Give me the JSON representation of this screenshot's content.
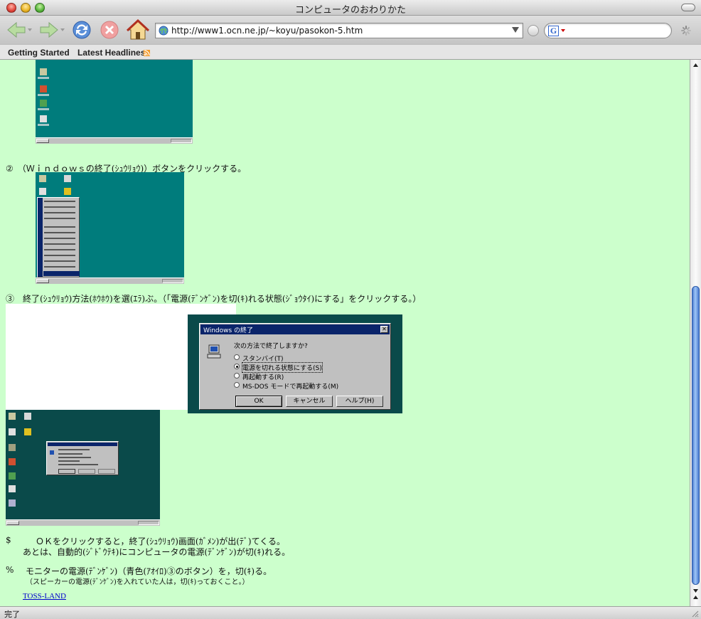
{
  "window": {
    "title": "コンピュータのおわりかた"
  },
  "toolbar": {
    "url": "http://www1.ocn.ne.jp/~koyu/pasokon-5.htm",
    "search_value": ""
  },
  "bookmarks": {
    "items": [
      {
        "label": "Getting Started"
      },
      {
        "label": "Latest Headlines"
      }
    ]
  },
  "content": {
    "step2": "②　（Ｗｉｎｄｏｗｓの終了(ｼｭｳﾘｮｳ)）ボタンをクリックする。",
    "step3": "③　終了(ｼｭｳﾘｮｳ)方法(ﾎｳﾎｳ)を選(ｴﾗ)ぶ。（「電源(ﾃﾞﾝｹﾞﾝ)を切(ｷ)れる状態(ｼﾞｮｳﾀｲ)にする」をクリックする。）",
    "step4_marker": "$",
    "step4_line1": "ＯＫをクリックすると，終了(ｼｭｳﾘｮｳ)画面(ｶﾞﾒﾝ)が出(ﾃﾞ)てくる。",
    "step4_line2": "あとは、自動的(ｼﾞﾄﾞｳﾃｷ)にコンピュータの電源(ﾃﾞﾝｹﾞﾝ)が切(ｷ)れる。",
    "step5_marker": "%",
    "step5_line1": "モニターの電源(ﾃﾞﾝｹﾞﾝ)（青色(ｱｵｲﾛ)③のボタン）を，切(ｷ)る。",
    "step5_line2": "（スピーカーの電源(ﾃﾞﾝｹﾞﾝ)を入れていた人は，切(ｷ)っておくこと。）",
    "link_label": "TOSS-LAND"
  },
  "dialog": {
    "title": "Windows の終了",
    "question": "次の方法で終了しますか?",
    "options": [
      {
        "label": "スタンバイ(T)",
        "selected": false
      },
      {
        "label": "電源を切れる状態にする(S)",
        "selected": true
      },
      {
        "label": "再起動する(R)",
        "selected": false
      },
      {
        "label": "MS-DOS モードで再起動する(M)",
        "selected": false
      }
    ],
    "buttons": {
      "ok": "OK",
      "cancel": "キャンセル",
      "help": "ヘルプ(H)"
    }
  },
  "status": {
    "text": "完了"
  },
  "colors": {
    "page_background": "#ccffcc",
    "desktop_teal": "#007c7c",
    "desktop_dark": "#0a4a4a",
    "link": "#0000cc",
    "win_title_blue": "#0a246a"
  }
}
